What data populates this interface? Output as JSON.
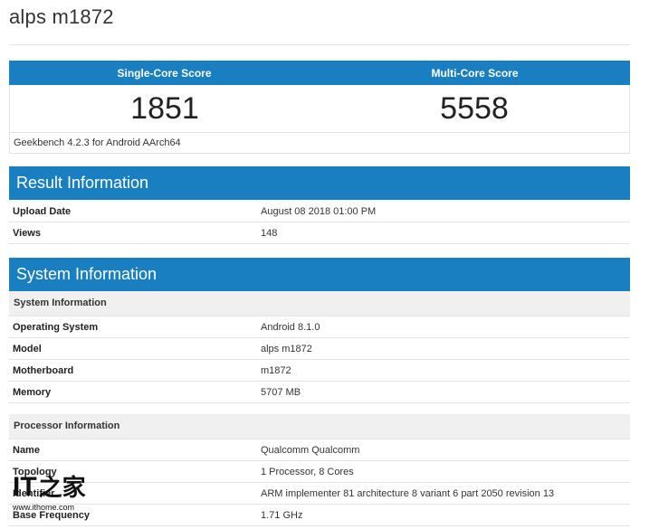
{
  "page": {
    "title": "alps m1872"
  },
  "scores": {
    "single_label": "Single-Core Score",
    "multi_label": "Multi-Core Score",
    "single_value": "1851",
    "multi_value": "5558",
    "version": "Geekbench 4.2.3 for Android AArch64"
  },
  "result": {
    "title": "Result Information",
    "rows": [
      {
        "label": "Upload Date",
        "value": "August 08 2018 01:00 PM"
      },
      {
        "label": "Views",
        "value": "148"
      }
    ]
  },
  "system": {
    "title": "System Information",
    "subhead1": "System Information",
    "rows1": [
      {
        "label": "Operating System",
        "value": "Android 8.1.0"
      },
      {
        "label": "Model",
        "value": "alps m1872"
      },
      {
        "label": "Motherboard",
        "value": "m1872"
      },
      {
        "label": "Memory",
        "value": "5707 MB"
      }
    ],
    "subhead2": "Processor Information",
    "rows2": [
      {
        "label": "Name",
        "value": "Qualcomm Qualcomm"
      },
      {
        "label": "Topology",
        "value": "1 Processor, 8 Cores"
      },
      {
        "label": "Identifier",
        "value": "ARM implementer 81 architecture 8 variant 6 part 2050 revision 13"
      },
      {
        "label": "Base Frequency",
        "value": "1.71 GHz"
      }
    ]
  },
  "watermark": {
    "logo_text": "IT",
    "logo_cn": "之家",
    "url": "www.ithome.com"
  },
  "colors": {
    "accent": "#1a7fc0",
    "subhead_bg": "#f0f0f0",
    "border": "#e3e3e3"
  }
}
